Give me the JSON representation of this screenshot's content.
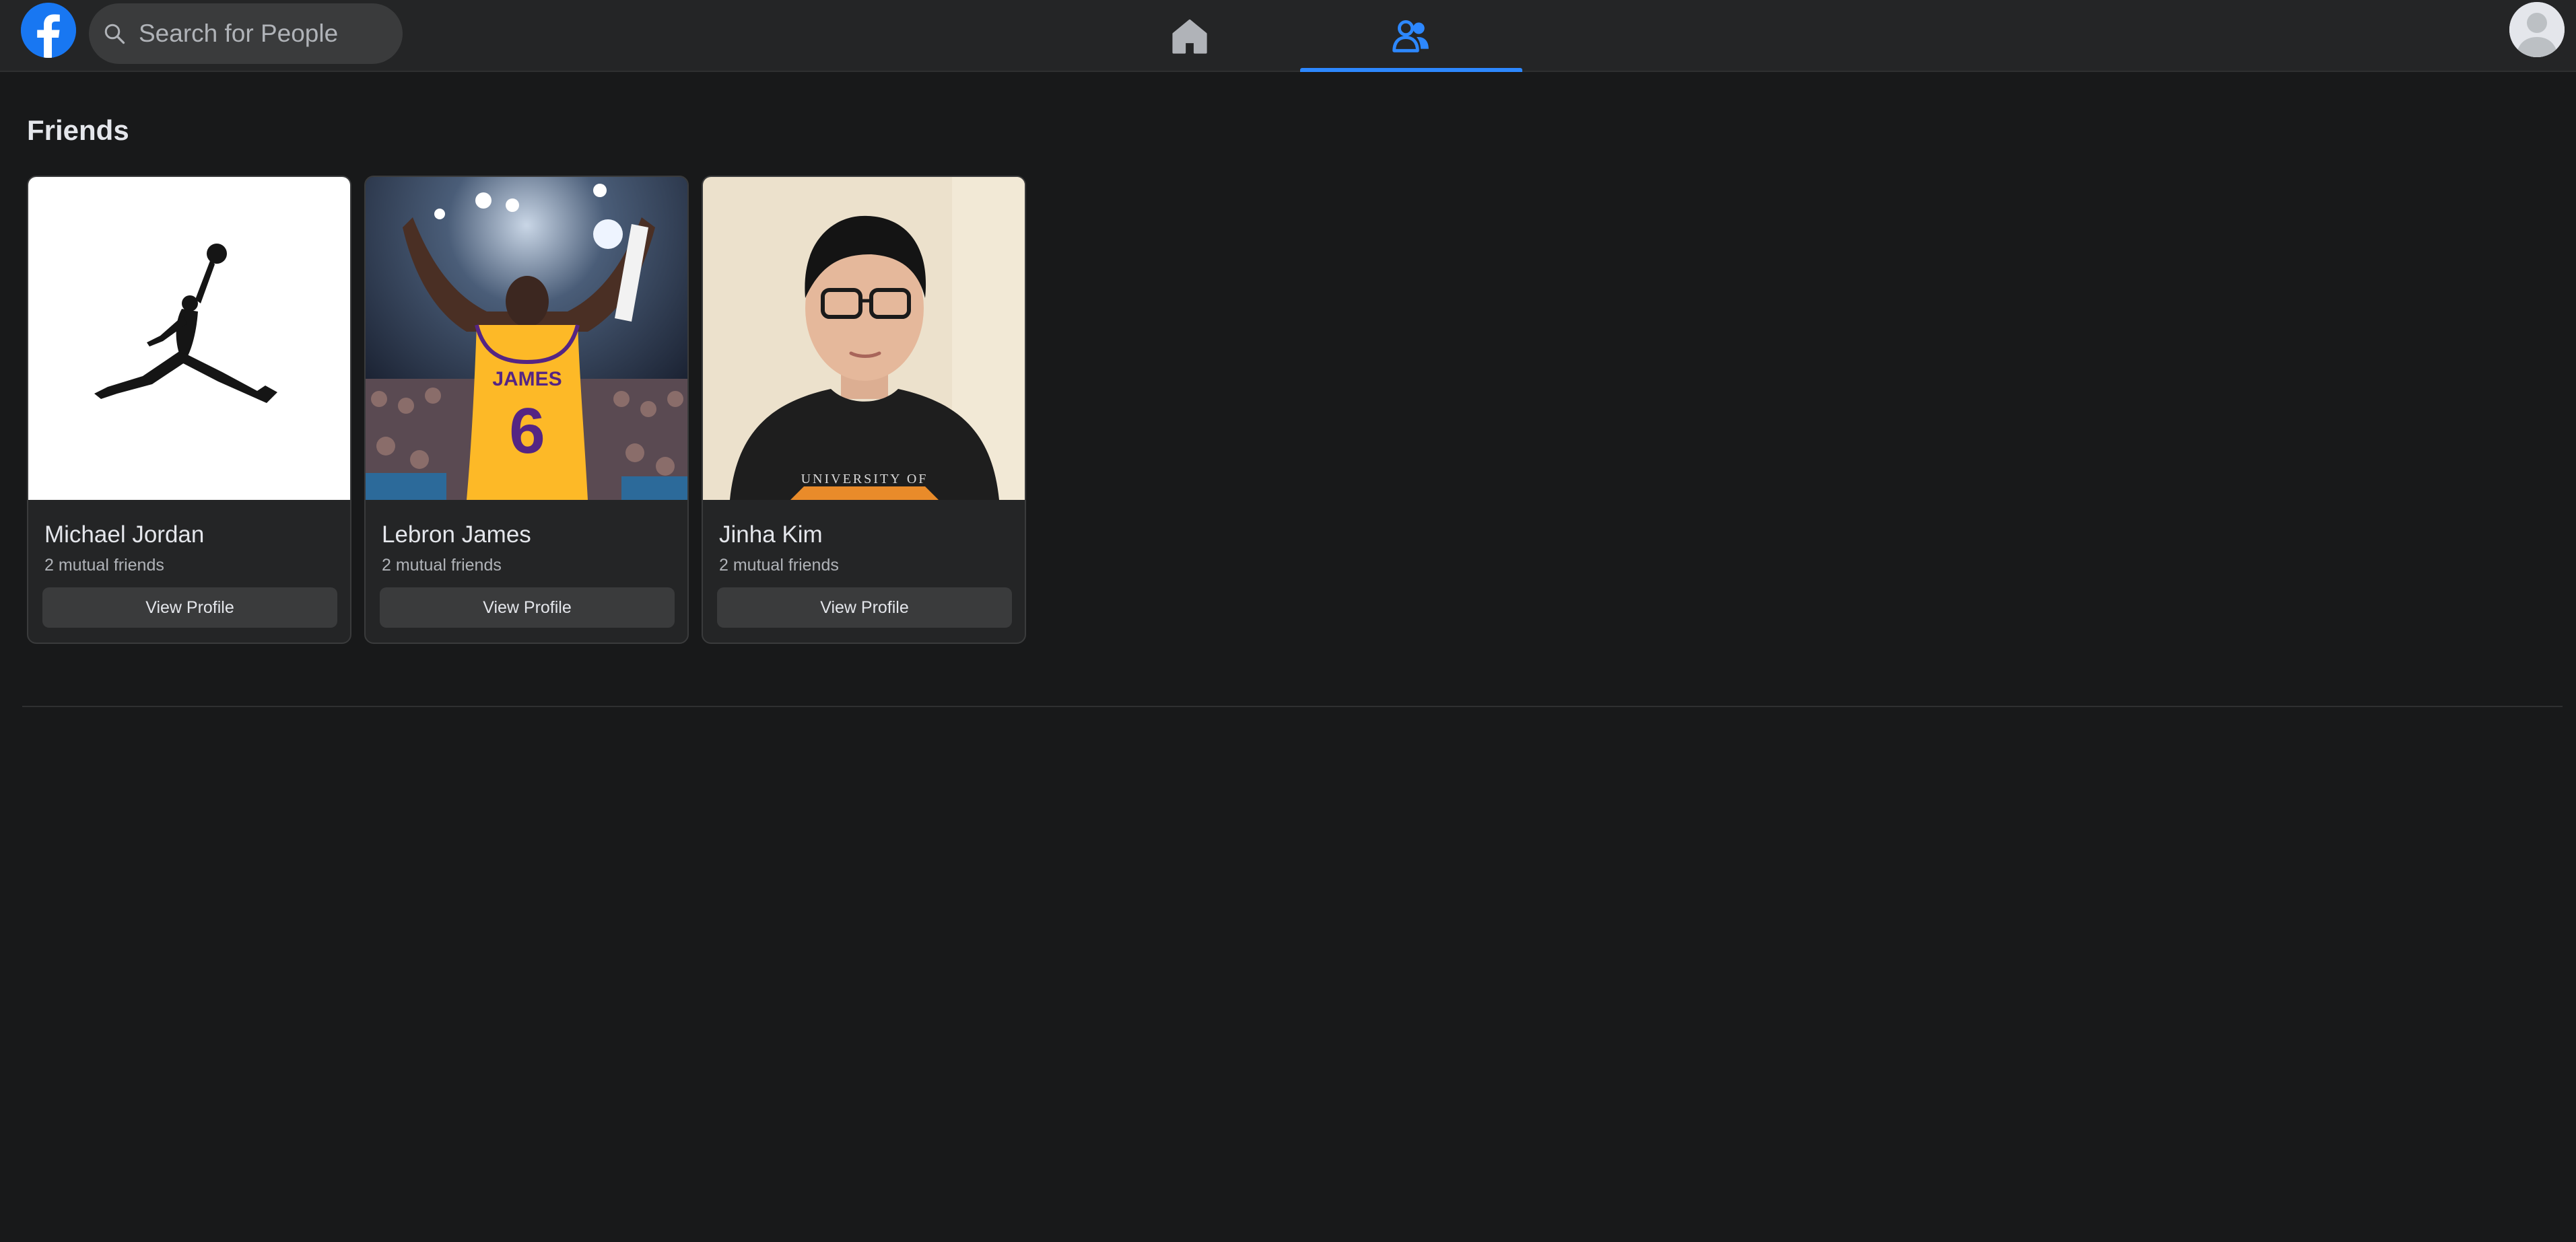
{
  "header": {
    "logo_icon": "facebook-logo-icon",
    "search": {
      "placeholder": "Search for People",
      "value": "",
      "icon": "search-icon"
    },
    "nav": [
      {
        "name": "home",
        "icon": "home-icon",
        "active": false
      },
      {
        "name": "friends",
        "icon": "friends-icon",
        "active": true
      }
    ],
    "profile_avatar_icon": "user-avatar-icon",
    "accent_color": "#2d88ff"
  },
  "main": {
    "title": "Friends",
    "friends": [
      {
        "name": "Michael Jordan",
        "mutual": "2 mutual friends",
        "button": "View Profile",
        "photo": "jumpman-logo"
      },
      {
        "name": "Lebron James",
        "mutual": "2 mutual friends",
        "button": "View Profile",
        "photo": "basketball-player-photo",
        "jersey_name": "JAMES",
        "jersey_number": "6"
      },
      {
        "name": "Jinha Kim",
        "mutual": "2 mutual friends",
        "button": "View Profile",
        "photo": "person-selfie-photo",
        "shirt_text": "UNIVERSITY OF"
      }
    ]
  }
}
